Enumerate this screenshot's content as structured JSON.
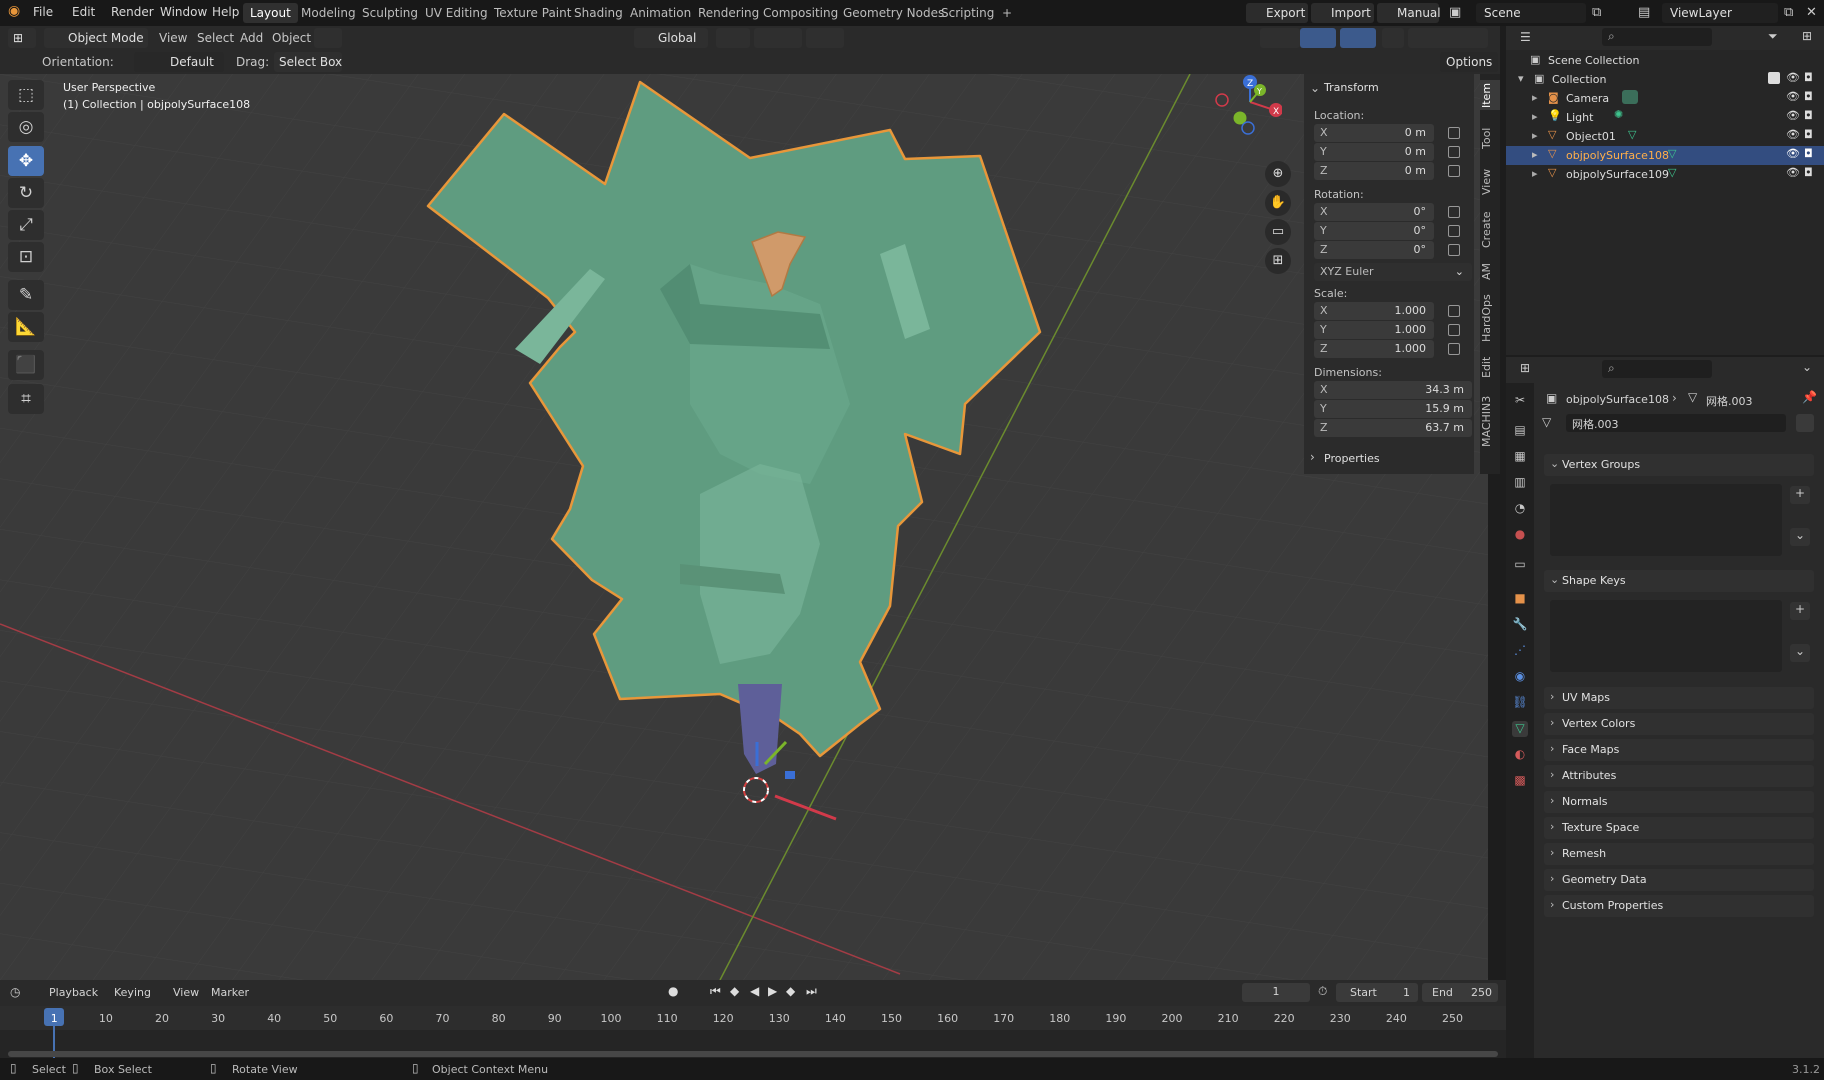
{
  "menubar": {
    "items": [
      "File",
      "Edit",
      "Render",
      "Window",
      "Help"
    ],
    "workspaces": [
      "Layout",
      "Modeling",
      "Sculpting",
      "UV Editing",
      "Texture Paint",
      "Shading",
      "Animation",
      "Rendering",
      "Compositing",
      "Geometry Nodes",
      "Scripting",
      "+"
    ],
    "active_workspace": "Layout",
    "export_label": "Export",
    "import_label": "Import",
    "manual_label": "Manual",
    "scene_label": "Scene",
    "viewlayer_label": "ViewLayer"
  },
  "viewport_header": {
    "mode": "Object Mode",
    "menu": [
      "View",
      "Select",
      "Add",
      "Object"
    ],
    "transform_orientation": "Global",
    "orientation_label": "Orientation:",
    "orientation_value": "Default",
    "drag_label": "Drag:",
    "drag_value": "Select Box",
    "options_label": "Options"
  },
  "viewport": {
    "perspective_label": "User Perspective",
    "collection_label": "(1) Collection | objpolySurface108",
    "navigation_axes": [
      "X",
      "Y",
      "Z"
    ]
  },
  "toolbar": {
    "tools": [
      "select-box",
      "cursor",
      "move",
      "rotate",
      "scale",
      "transform",
      "annotate",
      "measure",
      "add-cube",
      "shear"
    ],
    "active_tool": "move"
  },
  "npanel": {
    "tabs": [
      "Item",
      "Tool",
      "View",
      "Create",
      "AM",
      "HardOps",
      "Edit",
      "MACHIN3"
    ],
    "section": "Transform",
    "location_label": "Location:",
    "location": {
      "x": "0 m",
      "y": "0 m",
      "z": "0 m"
    },
    "rotation_label": "Rotation:",
    "rotation": {
      "x": "0°",
      "y": "0°",
      "z": "0°"
    },
    "rotation_mode": "XYZ Euler",
    "scale_label": "Scale:",
    "scale": {
      "x": "1.000",
      "y": "1.000",
      "z": "1.000"
    },
    "dimensions_label": "Dimensions:",
    "dimensions": {
      "x": "34.3 m",
      "y": "15.9 m",
      "z": "63.7 m"
    },
    "properties_label": "Properties",
    "axis_labels": [
      "X",
      "Y",
      "Z"
    ]
  },
  "outliner": {
    "root": "Scene Collection",
    "collection": "Collection",
    "items": [
      "Camera",
      "Light",
      "Object01",
      "objpolySurface108",
      "objpolySurface109"
    ],
    "selected": "objpolySurface108"
  },
  "properties": {
    "object_name": "objpolySurface108",
    "mesh_name": "网格.003",
    "mesh_field": "网格.003",
    "sections_open": [
      "Vertex Groups",
      "Shape Keys"
    ],
    "sections_closed": [
      "UV Maps",
      "Vertex Colors",
      "Face Maps",
      "Attributes",
      "Normals",
      "Texture Space",
      "Remesh",
      "Geometry Data",
      "Custom Properties"
    ]
  },
  "timeline": {
    "menu": [
      "Playback",
      "Keying",
      "View",
      "Marker"
    ],
    "current_frame": "1",
    "start_label": "Start",
    "start": "1",
    "end_label": "End",
    "end": "250",
    "ticks": [
      "1",
      "10",
      "20",
      "30",
      "40",
      "50",
      "60",
      "70",
      "80",
      "90",
      "100",
      "110",
      "120",
      "130",
      "140",
      "150",
      "160",
      "170",
      "180",
      "190",
      "200",
      "210",
      "220",
      "230",
      "240",
      "250"
    ]
  },
  "statusbar": {
    "select": "Select",
    "box_select": "Box Select",
    "rotate_view": "Rotate View",
    "context_menu": "Object Context Menu",
    "version": "3.1.2"
  },
  "colors": {
    "accent": "#4772b3",
    "selection_outline": "#e8973a",
    "mesh": "#5f9c80",
    "x_axis": "#c23b45",
    "y_axis": "#6f9b2a",
    "z_axis": "#3a6fd6"
  }
}
